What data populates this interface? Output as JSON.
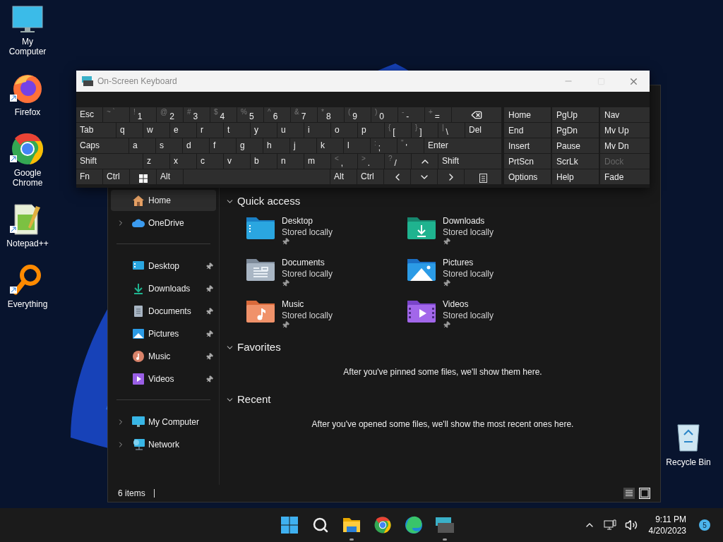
{
  "desktop_icons": [
    {
      "kind": "computer",
      "label": "My Computer",
      "shortcut": false
    },
    {
      "kind": "firefox",
      "label": "Firefox",
      "shortcut": true
    },
    {
      "kind": "chrome",
      "label": "Google Chrome",
      "shortcut": true
    },
    {
      "kind": "notepad",
      "label": "Notepad++",
      "shortcut": true
    },
    {
      "kind": "everything",
      "label": "Everything",
      "shortcut": true
    }
  ],
  "recycle_bin": {
    "label": "Recycle Bin"
  },
  "keyboard": {
    "title": "On-Screen Keyboard",
    "rows": [
      {
        "keys": [
          {
            "kind": "esc",
            "label": "Esc"
          },
          {
            "kind": "key",
            "shift": "~ `"
          },
          {
            "kind": "key",
            "shift": "!",
            "label": "1"
          },
          {
            "kind": "key",
            "shift": "@",
            "label": "2"
          },
          {
            "kind": "key",
            "shift": "#",
            "label": "3"
          },
          {
            "kind": "key",
            "shift": "$",
            "label": "4"
          },
          {
            "kind": "key",
            "shift": "%",
            "label": "5"
          },
          {
            "kind": "key",
            "shift": "^",
            "label": "6"
          },
          {
            "kind": "key",
            "shift": "&",
            "label": "7"
          },
          {
            "kind": "key",
            "shift": "*",
            "label": "8"
          },
          {
            "kind": "key",
            "shift": "(",
            "label": "9"
          },
          {
            "kind": "key",
            "shift": ")",
            "label": "0"
          },
          {
            "kind": "key",
            "shift": "-",
            "label": "-"
          },
          {
            "kind": "key",
            "shift": "+",
            "label": "="
          },
          {
            "kind": "backspace"
          }
        ]
      },
      {
        "keys": [
          {
            "kind": "tab",
            "label": "Tab"
          },
          {
            "kind": "key",
            "label": "q"
          },
          {
            "kind": "key",
            "label": "w"
          },
          {
            "kind": "key",
            "label": "e"
          },
          {
            "kind": "key",
            "label": "r"
          },
          {
            "kind": "key",
            "label": "t"
          },
          {
            "kind": "key",
            "label": "y"
          },
          {
            "kind": "key",
            "label": "u"
          },
          {
            "kind": "key",
            "label": "i"
          },
          {
            "kind": "key",
            "label": "o"
          },
          {
            "kind": "key",
            "label": "p"
          },
          {
            "kind": "key",
            "shift": "{",
            "label": "["
          },
          {
            "kind": "key",
            "shift": "}",
            "label": "]"
          },
          {
            "kind": "key",
            "shift": "|",
            "label": "\\"
          },
          {
            "kind": "fill",
            "label": "Del"
          }
        ]
      },
      {
        "keys": [
          {
            "kind": "caps",
            "label": "Caps"
          },
          {
            "kind": "key",
            "label": "a"
          },
          {
            "kind": "key",
            "label": "s"
          },
          {
            "kind": "key",
            "label": "d"
          },
          {
            "kind": "key",
            "label": "f"
          },
          {
            "kind": "key",
            "label": "g"
          },
          {
            "kind": "key",
            "label": "h"
          },
          {
            "kind": "key",
            "label": "j"
          },
          {
            "kind": "key",
            "label": "k"
          },
          {
            "kind": "key",
            "label": "l"
          },
          {
            "kind": "key",
            "shift": ":",
            "label": ";"
          },
          {
            "kind": "key",
            "shift": "\"",
            "label": "'"
          },
          {
            "kind": "fill",
            "label": "Enter"
          }
        ]
      },
      {
        "keys": [
          {
            "kind": "shift",
            "label": "Shift"
          },
          {
            "kind": "key",
            "label": "z"
          },
          {
            "kind": "key",
            "label": "x"
          },
          {
            "kind": "key",
            "label": "c"
          },
          {
            "kind": "key",
            "label": "v"
          },
          {
            "kind": "key",
            "label": "b"
          },
          {
            "kind": "key",
            "label": "n"
          },
          {
            "kind": "key",
            "label": "m"
          },
          {
            "kind": "key",
            "shift": "<",
            "label": ","
          },
          {
            "kind": "key",
            "shift": ">",
            "label": "."
          },
          {
            "kind": "key",
            "shift": "?",
            "label": "/"
          },
          {
            "kind": "up"
          },
          {
            "kind": "fill",
            "label": "Shift"
          }
        ]
      },
      {
        "keys": [
          {
            "kind": "esc",
            "label": "Fn"
          },
          {
            "kind": "key",
            "label": "Ctrl"
          },
          {
            "kind": "win"
          },
          {
            "kind": "key",
            "label": "Alt"
          },
          {
            "kind": "space"
          },
          {
            "kind": "key",
            "label": "Alt"
          },
          {
            "kind": "key",
            "label": "Ctrl"
          },
          {
            "kind": "left"
          },
          {
            "kind": "down"
          },
          {
            "kind": "right"
          },
          {
            "kind": "menu"
          }
        ]
      }
    ],
    "side_keys": [
      [
        {
          "label": "Home",
          "disabled": false
        },
        {
          "label": "PgUp",
          "disabled": false
        },
        {
          "label": "Nav",
          "disabled": false
        }
      ],
      [
        {
          "label": "End",
          "disabled": false
        },
        {
          "label": "PgDn",
          "disabled": false
        },
        {
          "label": "Mv Up",
          "disabled": false
        }
      ],
      [
        {
          "label": "Insert",
          "disabled": false
        },
        {
          "label": "Pause",
          "disabled": false
        },
        {
          "label": "Mv Dn",
          "disabled": false
        }
      ],
      [
        {
          "label": "PrtScn",
          "disabled": false
        },
        {
          "label": "ScrLk",
          "disabled": false
        },
        {
          "label": "Dock",
          "disabled": true
        }
      ],
      [
        {
          "label": "Options",
          "disabled": false
        },
        {
          "label": "Help",
          "disabled": false
        },
        {
          "label": "Fade",
          "disabled": false
        }
      ]
    ]
  },
  "explorer": {
    "sidebar": [
      [
        {
          "kind": "home",
          "label": "Home",
          "selected": true,
          "expandable": false,
          "pinned": false
        },
        {
          "kind": "onedrive",
          "label": "OneDrive",
          "selected": false,
          "expandable": true,
          "pinned": false
        }
      ],
      [
        {
          "kind": "desktop",
          "label": "Desktop",
          "selected": false,
          "expandable": false,
          "pinned": true
        },
        {
          "kind": "downloads",
          "label": "Downloads",
          "selected": false,
          "expandable": false,
          "pinned": true
        },
        {
          "kind": "documents",
          "label": "Documents",
          "selected": false,
          "expandable": false,
          "pinned": true
        },
        {
          "kind": "pictures",
          "label": "Pictures",
          "selected": false,
          "expandable": false,
          "pinned": true
        },
        {
          "kind": "music",
          "label": "Music",
          "selected": false,
          "expandable": false,
          "pinned": true
        },
        {
          "kind": "videos",
          "label": "Videos",
          "selected": false,
          "expandable": false,
          "pinned": true
        }
      ],
      [
        {
          "kind": "computer",
          "label": "My Computer",
          "selected": false,
          "expandable": true,
          "pinned": false
        },
        {
          "kind": "network",
          "label": "Network",
          "selected": false,
          "expandable": true,
          "pinned": false
        }
      ]
    ],
    "quick_access": {
      "title": "Quick access",
      "expanded": true,
      "items": [
        {
          "kind": "desktop",
          "name": "Desktop",
          "status": "Stored locally",
          "pinned": true
        },
        {
          "kind": "downloads",
          "name": "Downloads",
          "status": "Stored locally",
          "pinned": true
        },
        {
          "kind": "documents",
          "name": "Documents",
          "status": "Stored locally",
          "pinned": true
        },
        {
          "kind": "pictures",
          "name": "Pictures",
          "status": "Stored locally",
          "pinned": true
        },
        {
          "kind": "music",
          "name": "Music",
          "status": "Stored locally",
          "pinned": true
        },
        {
          "kind": "videos",
          "name": "Videos",
          "status": "Stored locally",
          "pinned": true
        }
      ]
    },
    "favorites": {
      "title": "Favorites",
      "expanded": true,
      "message": "After you've pinned some files, we'll show them here."
    },
    "recent": {
      "title": "Recent",
      "expanded": true,
      "message": "After you've opened some files, we'll show the most recent ones here."
    },
    "status": "6 items",
    "views": [
      {
        "kind": "details",
        "selected": false
      },
      {
        "kind": "tiles",
        "selected": true
      }
    ]
  },
  "taskbar": {
    "apps": [
      {
        "kind": "start",
        "running": false
      },
      {
        "kind": "search",
        "running": false
      },
      {
        "kind": "explorer",
        "running": true
      },
      {
        "kind": "chrome",
        "running": false
      },
      {
        "kind": "edge",
        "running": false
      },
      {
        "kind": "keyboard",
        "running": true
      }
    ],
    "time": "9:11 PM",
    "date": "4/20/2023",
    "notifications": "5"
  }
}
